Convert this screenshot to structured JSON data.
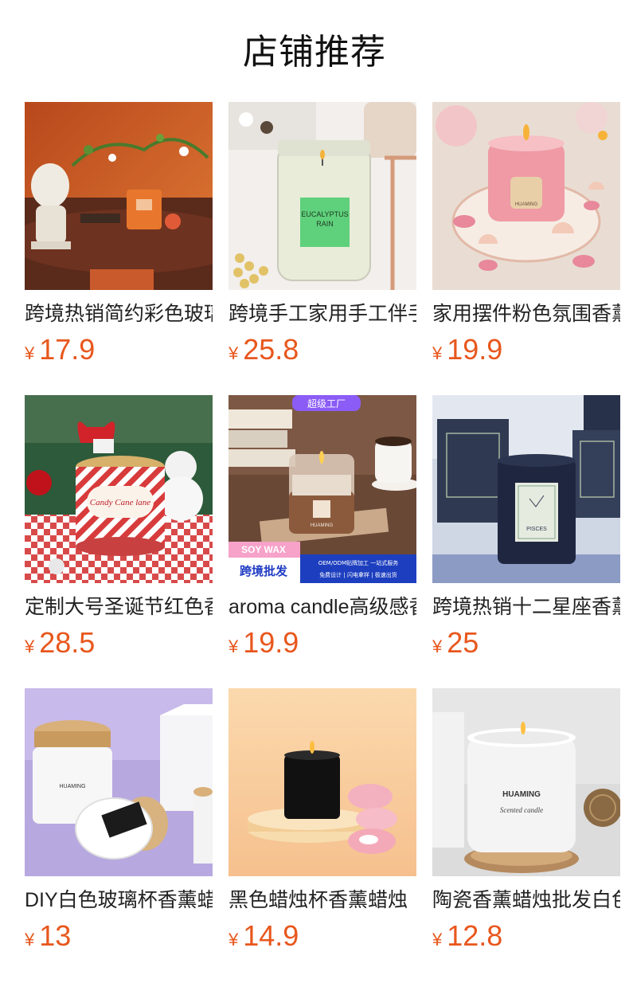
{
  "page": {
    "title": "店铺推荐"
  },
  "products": [
    {
      "name": "跨境热销简约彩色玻璃杯香薰蜡烛",
      "currency": "¥",
      "price": "17.9",
      "image_icon": "orange-candle-still-life-image"
    },
    {
      "name": "跨境手工家用手工伴手礼香薰蜡烛",
      "currency": "¥",
      "price": "25.8",
      "image_icon": "eucalyptus-rain-candle-image",
      "label_line1": "EUCALYPTUS",
      "label_line2": "RAIN"
    },
    {
      "name": "家用摆件粉色氛围香薰蜡烛",
      "currency": "¥",
      "price": "19.9",
      "image_icon": "pink-candle-shells-image",
      "brand": "HUAMING"
    },
    {
      "name": "定制大号圣诞节红色香薰蜡烛",
      "currency": "¥",
      "price": "28.5",
      "image_icon": "christmas-candy-cane-candle-image",
      "label": "Candy Cane lane"
    },
    {
      "name": "aroma candle高级感香薰蜡烛",
      "currency": "¥",
      "price": "19.9",
      "image_icon": "coffee-candle-factory-image",
      "badge": "超级工厂",
      "banner_left_top": "SOY WAX",
      "banner_left_bottom": "跨境批发",
      "banner_right_top": "OEM/ODM贴牌加工 一站式服务",
      "banner_right_bottom": "免费设计 | 闪电拿样 | 极速出货",
      "brand": "HUAMING"
    },
    {
      "name": "跨境热销十二星座香薰蜡烛",
      "currency": "¥",
      "price": "25",
      "image_icon": "pisces-zodiac-candle-image",
      "label": "PISCES"
    },
    {
      "name": "DIY白色玻璃杯香薰蜡烛",
      "currency": "¥",
      "price": "13",
      "image_icon": "white-glass-wood-lid-candle-image",
      "brand": "HUAMING"
    },
    {
      "name": "黑色蜡烛杯香薰蜡烛",
      "currency": "¥",
      "price": "14.9",
      "image_icon": "black-candle-macaron-image"
    },
    {
      "name": "陶瓷香薰蜡烛批发白色",
      "currency": "¥",
      "price": "12.8",
      "image_icon": "ceramic-white-candle-image",
      "brand": "HUAMING",
      "sub": "Scented candle"
    }
  ],
  "colors": {
    "price": "#e8571d",
    "text": "#222222"
  }
}
